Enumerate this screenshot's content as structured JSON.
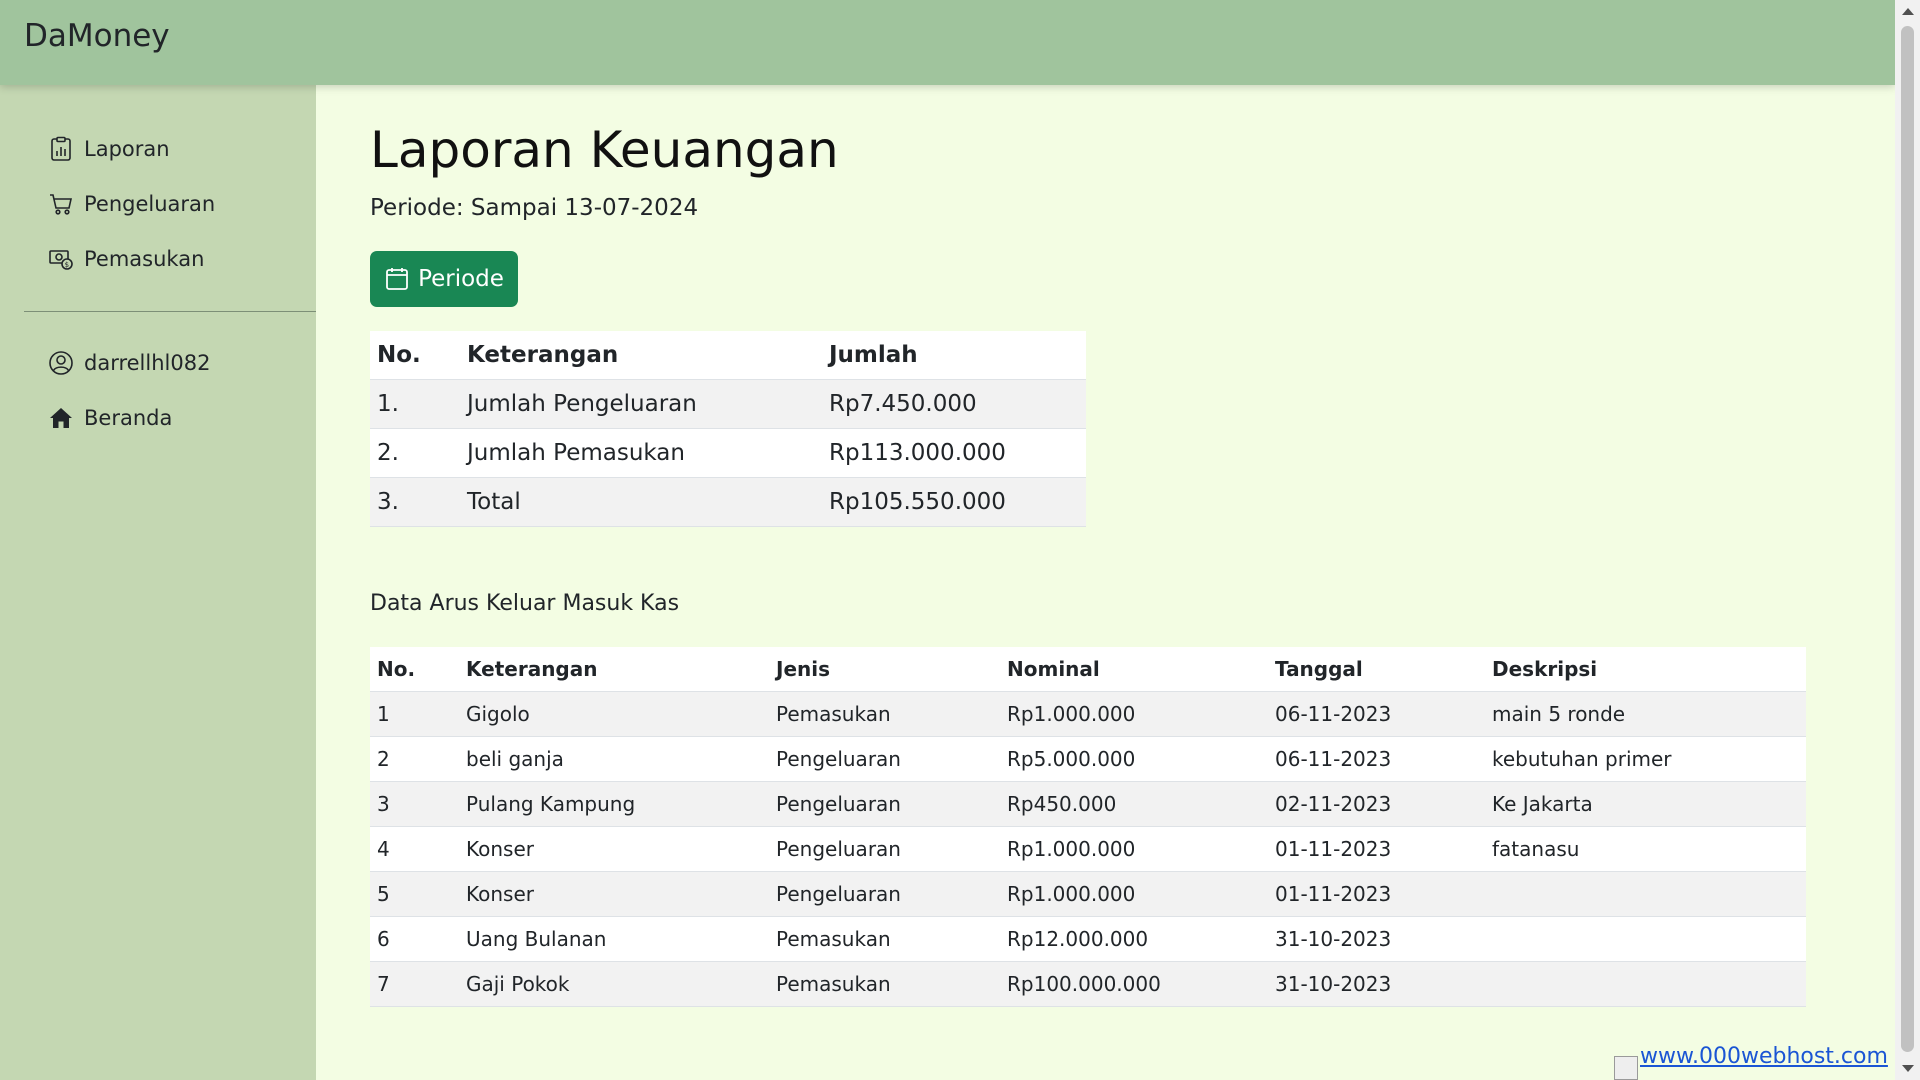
{
  "app": {
    "brand": "DaMoney"
  },
  "sidebar": {
    "items": [
      {
        "label": "Laporan",
        "icon": "report-chart-icon"
      },
      {
        "label": "Pengeluaran",
        "icon": "cart-icon"
      },
      {
        "label": "Pemasukan",
        "icon": "cash-coin-icon"
      }
    ],
    "user_items": [
      {
        "label": "darrellhl082",
        "icon": "user-circle-icon"
      },
      {
        "label": "Beranda",
        "icon": "house-icon"
      }
    ]
  },
  "main": {
    "title": "Laporan Keuangan",
    "period": "Periode: Sampai 13-07-2024",
    "period_button": "Periode",
    "summary": {
      "headers": [
        "No.",
        "Keterangan",
        "Jumlah"
      ],
      "rows": [
        [
          "1.",
          "Jumlah Pengeluaran",
          "Rp7.450.000"
        ],
        [
          "2.",
          "Jumlah Pemasukan",
          "Rp113.000.000"
        ],
        [
          "3.",
          "Total",
          "Rp105.550.000"
        ]
      ]
    },
    "cashflow_title": "Data Arus Keluar Masuk Kas",
    "cashflow": {
      "headers": [
        "No.",
        "Keterangan",
        "Jenis",
        "Nominal",
        "Tanggal",
        "Deskripsi"
      ],
      "rows": [
        [
          "1",
          "Gigolo",
          "Pemasukan",
          "Rp1.000.000",
          "06-11-2023",
          "main 5 ronde"
        ],
        [
          "2",
          "beli ganja",
          "Pengeluaran",
          "Rp5.000.000",
          "06-11-2023",
          "kebutuhan primer"
        ],
        [
          "3",
          "Pulang Kampung",
          "Pengeluaran",
          "Rp450.000",
          "02-11-2023",
          "Ke Jakarta"
        ],
        [
          "4",
          "Konser",
          "Pengeluaran",
          "Rp1.000.000",
          "01-11-2023",
          "fatanasu"
        ],
        [
          "5",
          "Konser",
          "Pengeluaran",
          "Rp1.000.000",
          "01-11-2023",
          ""
        ],
        [
          "6",
          "Uang Bulanan",
          "Pemasukan",
          "Rp12.000.000",
          "31-10-2023",
          ""
        ],
        [
          "7",
          "Gaji Pokok",
          "Pemasukan",
          "Rp100.000.000",
          "31-10-2023",
          ""
        ]
      ]
    }
  },
  "footer": {
    "link": "www.000webhost.com"
  },
  "colors": {
    "topbar": "#a0c49d",
    "sidebar": "#c4d7b2",
    "main_bg": "#f3fde3",
    "button": "#198754"
  }
}
